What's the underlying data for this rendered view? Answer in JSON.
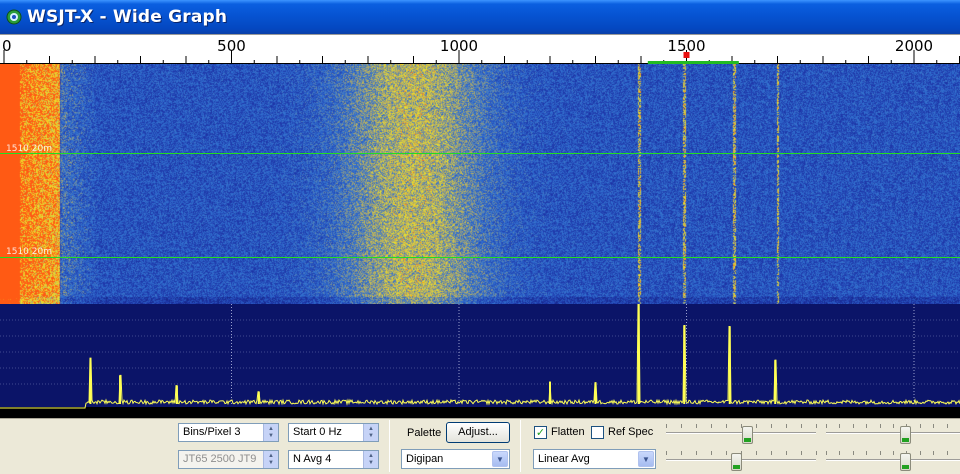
{
  "window": {
    "title": "WSJT-X - Wide Graph",
    "icon": "wsjtx-app-icon"
  },
  "scale": {
    "ticks": [
      {
        "label": "0",
        "freq": 0
      },
      {
        "label": "500",
        "freq": 500
      },
      {
        "label": "1000",
        "freq": 1000
      },
      {
        "label": "1500",
        "freq": 1500
      },
      {
        "label": "2000",
        "freq": 2000
      }
    ],
    "max_freq": 2110,
    "marker_freq": 1500,
    "tx_band": [
      1415,
      1615
    ],
    "marker_color": "#e81010",
    "tx_band_color": "#22bb22"
  },
  "waterfall": {
    "band_labels": [
      {
        "text": "1510 20m"
      },
      {
        "text": "1510 20m"
      }
    ],
    "band_line_color": "#22dd22",
    "vertical_traces_freq": [
      1395,
      1495,
      1605,
      1700
    ]
  },
  "spectrum": {
    "peaks": [
      {
        "freq": 1395,
        "level": 0.98
      },
      {
        "freq": 1495,
        "level": 0.77
      },
      {
        "freq": 1595,
        "level": 0.76
      },
      {
        "freq": 1695,
        "level": 0.43
      },
      {
        "freq": 190,
        "level": 0.45
      },
      {
        "freq": 255,
        "level": 0.28
      },
      {
        "freq": 1200,
        "level": 0.22
      },
      {
        "freq": 1300,
        "level": 0.21
      },
      {
        "freq": 380,
        "level": 0.18
      },
      {
        "freq": 560,
        "level": 0.12
      }
    ],
    "line_color": "#ffff55"
  },
  "controls": {
    "bins_per_pixel": "Bins/Pixel  3",
    "start_hz": "Start 0 Hz",
    "mode_spin": "JT65  2500  JT9",
    "n_avg": "N Avg 4",
    "palette_label": "Palette",
    "adjust_label": "Adjust...",
    "palette_value": "Digipan",
    "flatten_label": "Flatten",
    "flatten_checked": true,
    "ref_spec_label": "Ref Spec",
    "ref_spec_checked": false,
    "spec_mode_value": "Linear Avg",
    "sliders": [
      {
        "name": "gain-slider",
        "value": 0.55
      },
      {
        "name": "zero-slider",
        "value": 0.6
      },
      {
        "name": "spec-gain-slider",
        "value": 0.47
      },
      {
        "name": "spec-zero-slider",
        "value": 0.6
      }
    ],
    "accent_color": "#21a121"
  }
}
